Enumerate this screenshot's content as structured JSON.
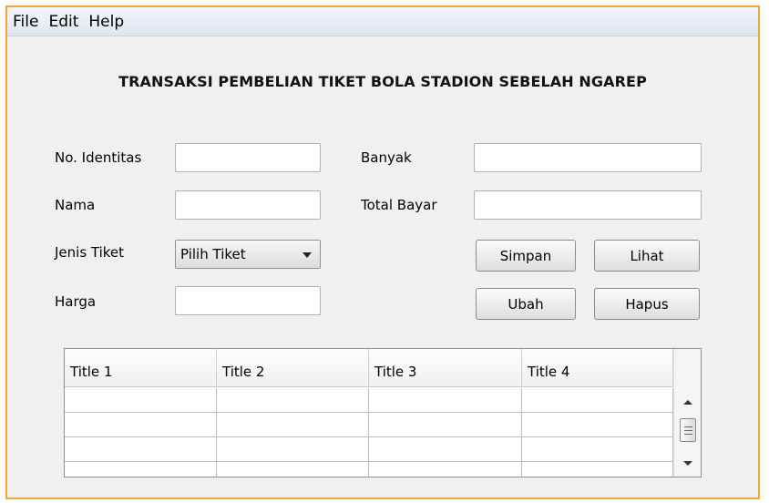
{
  "menu": {
    "items": [
      "File",
      "Edit",
      "Help"
    ]
  },
  "form": {
    "title": "TRANSAKSI PEMBELIAN TIKET BOLA STADION SEBELAH NGAREP",
    "labels": {
      "identitas": "No. Identitas",
      "nama": "Nama",
      "jenis": "Jenis Tiket",
      "harga": "Harga",
      "banyak": "Banyak",
      "total": "Total Bayar"
    },
    "values": {
      "identitas": "",
      "nama": "",
      "harga": "",
      "banyak": "",
      "total": ""
    },
    "jenis_selected": "Pilih Tiket"
  },
  "buttons": {
    "simpan": "Simpan",
    "lihat": "Lihat",
    "ubah": "Ubah",
    "hapus": "Hapus"
  },
  "table": {
    "columns": [
      "Title 1",
      "Title 2",
      "Title 3",
      "Title 4"
    ],
    "rows": [
      [
        "",
        "",
        "",
        ""
      ],
      [
        "",
        "",
        "",
        ""
      ],
      [
        "",
        "",
        "",
        ""
      ],
      [
        "",
        "",
        "",
        ""
      ]
    ]
  },
  "icons": {
    "dropdown": "chevron-down-icon",
    "scroll_up": "scroll-up-icon",
    "scroll_down": "scroll-down-icon"
  }
}
